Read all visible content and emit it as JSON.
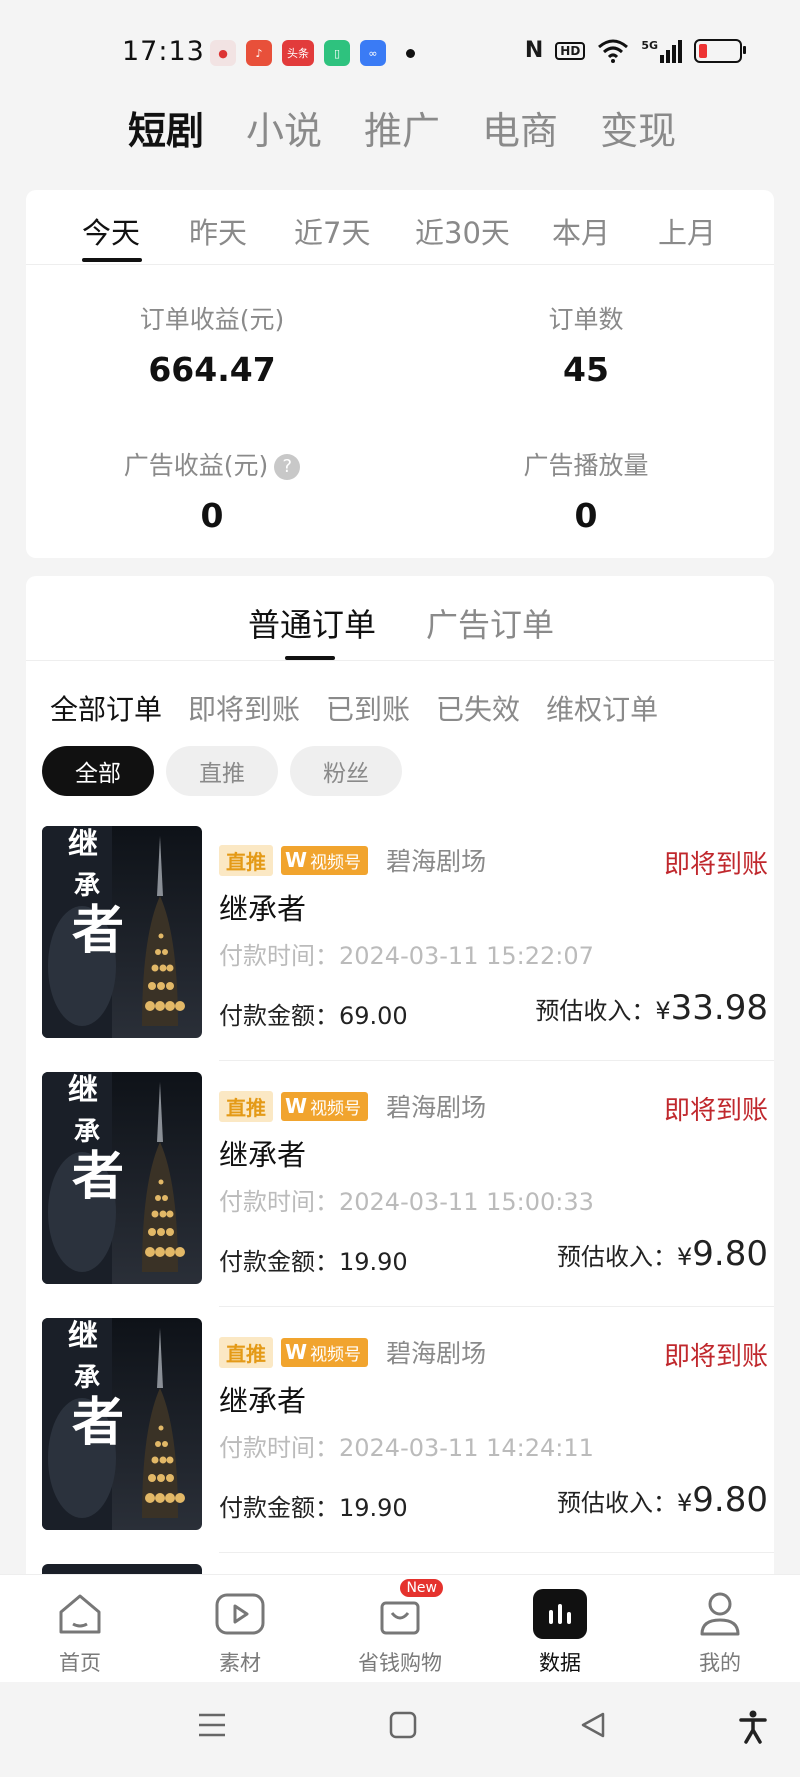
{
  "status_bar": {
    "time": "17:13",
    "app_icons": [
      {
        "name": "weibo-icon",
        "color": "#f2e3e3"
      },
      {
        "name": "music-icon",
        "color": "#e8503a"
      },
      {
        "name": "toutiao-icon",
        "color": "#e23b3b",
        "text": "头条"
      },
      {
        "name": "app-icon-green",
        "color": "#2ec27e"
      },
      {
        "name": "app-icon-blue",
        "color": "#3a7bf5"
      }
    ],
    "network": "5G",
    "hd_label": "HD"
  },
  "top_tabs": [
    {
      "label": "短剧",
      "active": true
    },
    {
      "label": "小说",
      "active": false
    },
    {
      "label": "推广",
      "active": false
    },
    {
      "label": "电商",
      "active": false
    },
    {
      "label": "变现",
      "active": false
    }
  ],
  "date_tabs": [
    {
      "label": "今天",
      "active": true
    },
    {
      "label": "昨天",
      "active": false
    },
    {
      "label": "近7天",
      "active": false
    },
    {
      "label": "近30天",
      "active": false
    },
    {
      "label": "本月",
      "active": false
    },
    {
      "label": "上月",
      "active": false
    }
  ],
  "stats": {
    "order_revenue": {
      "label": "订单收益(元)",
      "value": "664.47"
    },
    "order_count": {
      "label": "订单数",
      "value": "45"
    },
    "ad_revenue": {
      "label": "广告收益(元)",
      "value": "0",
      "help": "?"
    },
    "ad_plays": {
      "label": "广告播放量",
      "value": "0"
    }
  },
  "order_type_tabs": [
    {
      "label": "普通订单",
      "active": true
    },
    {
      "label": "广告订单",
      "active": false
    }
  ],
  "status_tabs": [
    {
      "label": "全部订单",
      "active": true
    },
    {
      "label": "即将到账",
      "active": false
    },
    {
      "label": "已到账",
      "active": false
    },
    {
      "label": "已失效",
      "active": false
    },
    {
      "label": "维权订单",
      "active": false
    }
  ],
  "filter_chips": [
    {
      "label": "全部",
      "active": true
    },
    {
      "label": "直推",
      "active": false
    },
    {
      "label": "粉丝",
      "active": false
    }
  ],
  "orders": [
    {
      "tag_direct": "直推",
      "tag_channel": "视频号",
      "theater": "碧海剧场",
      "status": "即将到账",
      "title": "继承者",
      "pay_time": "付款时间：2024-03-11 15:22:07",
      "pay_amount": "付款金额：69.00",
      "income_label": "预估收入：¥",
      "income_value": "33.98"
    },
    {
      "tag_direct": "直推",
      "tag_channel": "视频号",
      "theater": "碧海剧场",
      "status": "即将到账",
      "title": "继承者",
      "pay_time": "付款时间：2024-03-11 15:00:33",
      "pay_amount": "付款金额：19.90",
      "income_label": "预估收入：¥",
      "income_value": "9.80"
    },
    {
      "tag_direct": "直推",
      "tag_channel": "视频号",
      "theater": "碧海剧场",
      "status": "即将到账",
      "title": "继承者",
      "pay_time": "付款时间：2024-03-11 14:24:11",
      "pay_amount": "付款金额：19.90",
      "income_label": "预估收入：¥",
      "income_value": "9.80"
    }
  ],
  "poster_text": [
    "继",
    "承",
    "者"
  ],
  "bottom_nav": [
    {
      "label": "首页",
      "icon": "home-icon",
      "active": false
    },
    {
      "label": "素材",
      "icon": "play-icon",
      "active": false
    },
    {
      "label": "省钱购物",
      "icon": "shopping-bag-icon",
      "active": false,
      "badge": "New"
    },
    {
      "label": "数据",
      "icon": "bar-chart-icon",
      "active": true
    },
    {
      "label": "我的",
      "icon": "profile-icon",
      "active": false
    }
  ],
  "colors": {
    "accent_status": "#c0282d",
    "tag_orange": "#f1a42e",
    "active_black": "#111111"
  }
}
